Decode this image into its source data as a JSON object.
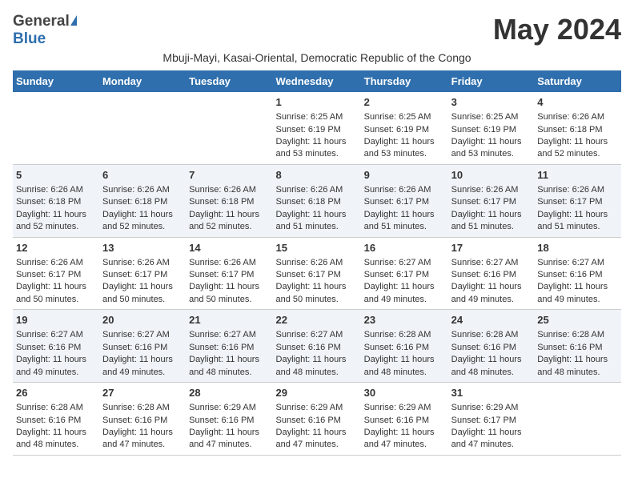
{
  "logo": {
    "general": "General",
    "blue": "Blue"
  },
  "title": "May 2024",
  "subtitle": "Mbuji-Mayi, Kasai-Oriental, Democratic Republic of the Congo",
  "days_of_week": [
    "Sunday",
    "Monday",
    "Tuesday",
    "Wednesday",
    "Thursday",
    "Friday",
    "Saturday"
  ],
  "weeks": [
    [
      {
        "day": "",
        "sunrise": "",
        "sunset": "",
        "daylight": ""
      },
      {
        "day": "",
        "sunrise": "",
        "sunset": "",
        "daylight": ""
      },
      {
        "day": "",
        "sunrise": "",
        "sunset": "",
        "daylight": ""
      },
      {
        "day": "1",
        "sunrise": "Sunrise: 6:25 AM",
        "sunset": "Sunset: 6:19 PM",
        "daylight": "Daylight: 11 hours and 53 minutes."
      },
      {
        "day": "2",
        "sunrise": "Sunrise: 6:25 AM",
        "sunset": "Sunset: 6:19 PM",
        "daylight": "Daylight: 11 hours and 53 minutes."
      },
      {
        "day": "3",
        "sunrise": "Sunrise: 6:25 AM",
        "sunset": "Sunset: 6:19 PM",
        "daylight": "Daylight: 11 hours and 53 minutes."
      },
      {
        "day": "4",
        "sunrise": "Sunrise: 6:26 AM",
        "sunset": "Sunset: 6:18 PM",
        "daylight": "Daylight: 11 hours and 52 minutes."
      }
    ],
    [
      {
        "day": "5",
        "sunrise": "Sunrise: 6:26 AM",
        "sunset": "Sunset: 6:18 PM",
        "daylight": "Daylight: 11 hours and 52 minutes."
      },
      {
        "day": "6",
        "sunrise": "Sunrise: 6:26 AM",
        "sunset": "Sunset: 6:18 PM",
        "daylight": "Daylight: 11 hours and 52 minutes."
      },
      {
        "day": "7",
        "sunrise": "Sunrise: 6:26 AM",
        "sunset": "Sunset: 6:18 PM",
        "daylight": "Daylight: 11 hours and 52 minutes."
      },
      {
        "day": "8",
        "sunrise": "Sunrise: 6:26 AM",
        "sunset": "Sunset: 6:18 PM",
        "daylight": "Daylight: 11 hours and 51 minutes."
      },
      {
        "day": "9",
        "sunrise": "Sunrise: 6:26 AM",
        "sunset": "Sunset: 6:17 PM",
        "daylight": "Daylight: 11 hours and 51 minutes."
      },
      {
        "day": "10",
        "sunrise": "Sunrise: 6:26 AM",
        "sunset": "Sunset: 6:17 PM",
        "daylight": "Daylight: 11 hours and 51 minutes."
      },
      {
        "day": "11",
        "sunrise": "Sunrise: 6:26 AM",
        "sunset": "Sunset: 6:17 PM",
        "daylight": "Daylight: 11 hours and 51 minutes."
      }
    ],
    [
      {
        "day": "12",
        "sunrise": "Sunrise: 6:26 AM",
        "sunset": "Sunset: 6:17 PM",
        "daylight": "Daylight: 11 hours and 50 minutes."
      },
      {
        "day": "13",
        "sunrise": "Sunrise: 6:26 AM",
        "sunset": "Sunset: 6:17 PM",
        "daylight": "Daylight: 11 hours and 50 minutes."
      },
      {
        "day": "14",
        "sunrise": "Sunrise: 6:26 AM",
        "sunset": "Sunset: 6:17 PM",
        "daylight": "Daylight: 11 hours and 50 minutes."
      },
      {
        "day": "15",
        "sunrise": "Sunrise: 6:26 AM",
        "sunset": "Sunset: 6:17 PM",
        "daylight": "Daylight: 11 hours and 50 minutes."
      },
      {
        "day": "16",
        "sunrise": "Sunrise: 6:27 AM",
        "sunset": "Sunset: 6:17 PM",
        "daylight": "Daylight: 11 hours and 49 minutes."
      },
      {
        "day": "17",
        "sunrise": "Sunrise: 6:27 AM",
        "sunset": "Sunset: 6:16 PM",
        "daylight": "Daylight: 11 hours and 49 minutes."
      },
      {
        "day": "18",
        "sunrise": "Sunrise: 6:27 AM",
        "sunset": "Sunset: 6:16 PM",
        "daylight": "Daylight: 11 hours and 49 minutes."
      }
    ],
    [
      {
        "day": "19",
        "sunrise": "Sunrise: 6:27 AM",
        "sunset": "Sunset: 6:16 PM",
        "daylight": "Daylight: 11 hours and 49 minutes."
      },
      {
        "day": "20",
        "sunrise": "Sunrise: 6:27 AM",
        "sunset": "Sunset: 6:16 PM",
        "daylight": "Daylight: 11 hours and 49 minutes."
      },
      {
        "day": "21",
        "sunrise": "Sunrise: 6:27 AM",
        "sunset": "Sunset: 6:16 PM",
        "daylight": "Daylight: 11 hours and 48 minutes."
      },
      {
        "day": "22",
        "sunrise": "Sunrise: 6:27 AM",
        "sunset": "Sunset: 6:16 PM",
        "daylight": "Daylight: 11 hours and 48 minutes."
      },
      {
        "day": "23",
        "sunrise": "Sunrise: 6:28 AM",
        "sunset": "Sunset: 6:16 PM",
        "daylight": "Daylight: 11 hours and 48 minutes."
      },
      {
        "day": "24",
        "sunrise": "Sunrise: 6:28 AM",
        "sunset": "Sunset: 6:16 PM",
        "daylight": "Daylight: 11 hours and 48 minutes."
      },
      {
        "day": "25",
        "sunrise": "Sunrise: 6:28 AM",
        "sunset": "Sunset: 6:16 PM",
        "daylight": "Daylight: 11 hours and 48 minutes."
      }
    ],
    [
      {
        "day": "26",
        "sunrise": "Sunrise: 6:28 AM",
        "sunset": "Sunset: 6:16 PM",
        "daylight": "Daylight: 11 hours and 48 minutes."
      },
      {
        "day": "27",
        "sunrise": "Sunrise: 6:28 AM",
        "sunset": "Sunset: 6:16 PM",
        "daylight": "Daylight: 11 hours and 47 minutes."
      },
      {
        "day": "28",
        "sunrise": "Sunrise: 6:29 AM",
        "sunset": "Sunset: 6:16 PM",
        "daylight": "Daylight: 11 hours and 47 minutes."
      },
      {
        "day": "29",
        "sunrise": "Sunrise: 6:29 AM",
        "sunset": "Sunset: 6:16 PM",
        "daylight": "Daylight: 11 hours and 47 minutes."
      },
      {
        "day": "30",
        "sunrise": "Sunrise: 6:29 AM",
        "sunset": "Sunset: 6:16 PM",
        "daylight": "Daylight: 11 hours and 47 minutes."
      },
      {
        "day": "31",
        "sunrise": "Sunrise: 6:29 AM",
        "sunset": "Sunset: 6:17 PM",
        "daylight": "Daylight: 11 hours and 47 minutes."
      },
      {
        "day": "",
        "sunrise": "",
        "sunset": "",
        "daylight": ""
      }
    ]
  ]
}
